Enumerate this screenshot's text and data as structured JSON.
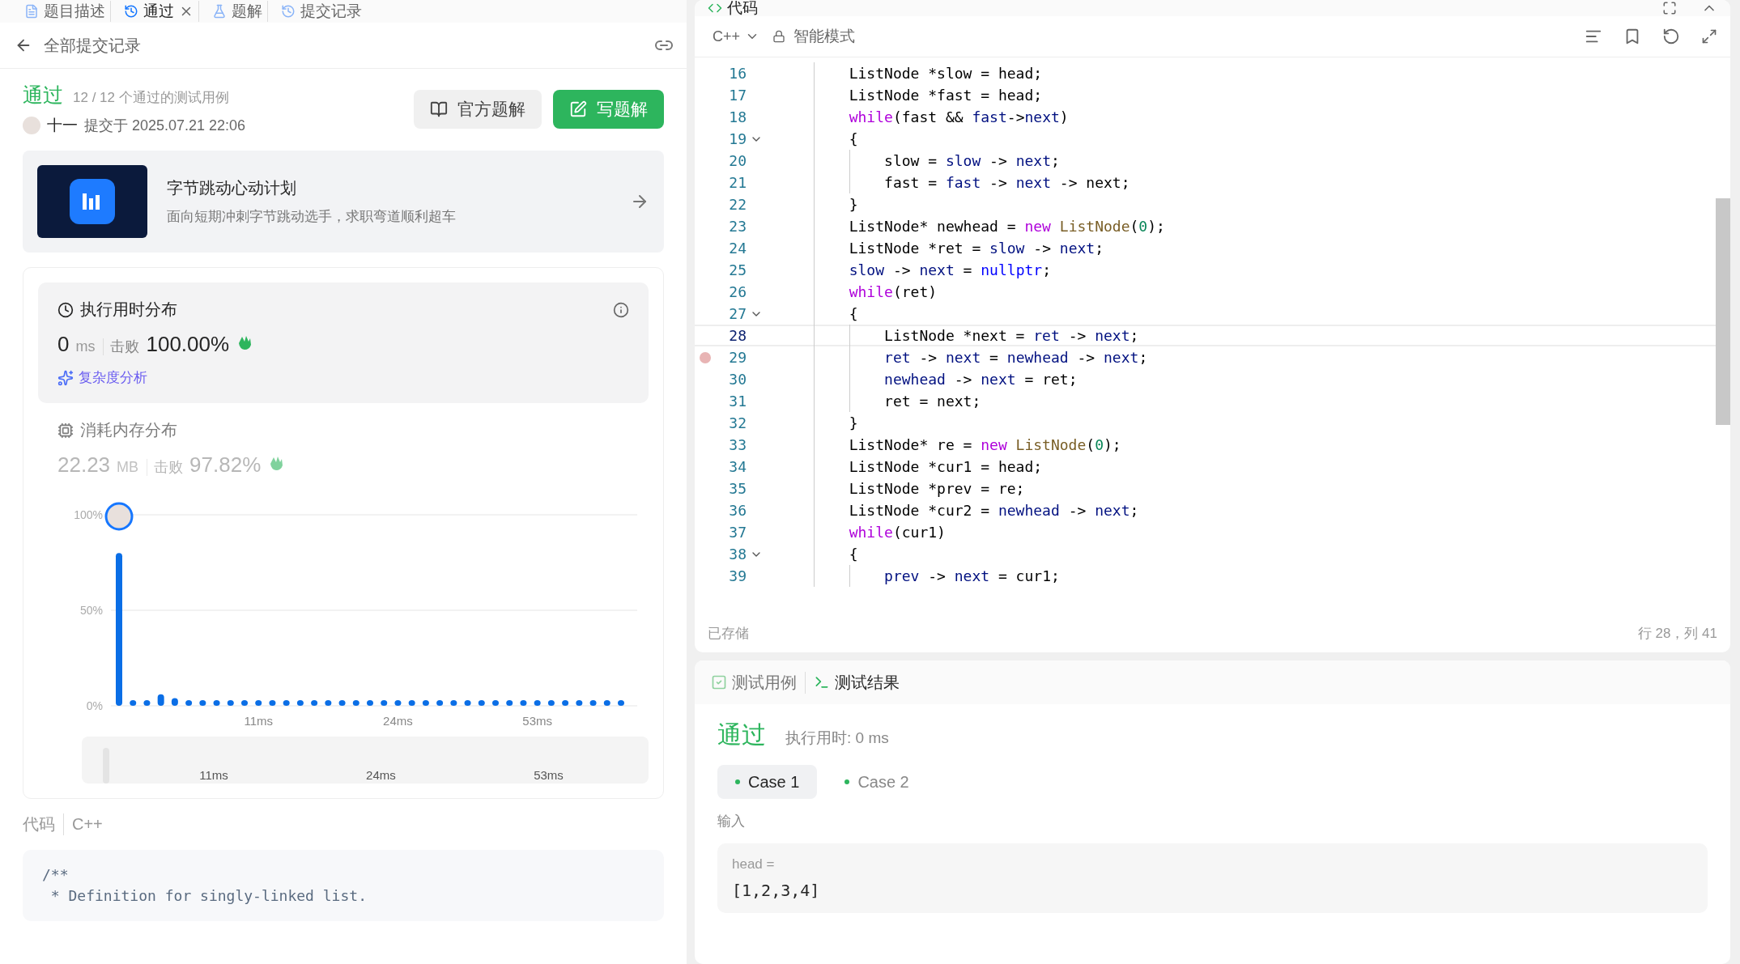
{
  "left_tabs": [
    {
      "label": "题目描述",
      "selected": false,
      "closable": false
    },
    {
      "label": "通过",
      "selected": true,
      "closable": true
    },
    {
      "label": "题解",
      "selected": false,
      "closable": false
    },
    {
      "label": "提交记录",
      "selected": false,
      "closable": false
    }
  ],
  "back_label": "全部提交记录",
  "submission": {
    "status": "通过",
    "cases": "12 / 12 个通过的测试用例",
    "user": "十一",
    "submitted": "提交于 2025.07.21 22:06"
  },
  "actions": [
    {
      "label": "官方题解",
      "kind": "secondary"
    },
    {
      "label": "写题解",
      "kind": "primary"
    }
  ],
  "promo": {
    "title": "字节跳动心动计划",
    "subtitle": "面向短期冲刺字节跳动选手，求职弯道顺利超车"
  },
  "runtime": {
    "title": "执行用时分布",
    "value": "0",
    "unit": "ms",
    "beats_label": "击败",
    "beats": "100.00%",
    "link": "复杂度分析",
    "selected": true
  },
  "memory": {
    "title": "消耗内存分布",
    "value": "22.23",
    "unit": "MB",
    "beats_label": "击败",
    "beats": "97.82%",
    "selected": false
  },
  "distribution": {
    "chart_data": {
      "type": "bar",
      "ylim": [
        0,
        100
      ],
      "yticks": [
        {
          "value": 0,
          "label": "0%"
        },
        {
          "value": 50,
          "label": "50%"
        },
        {
          "value": 100,
          "label": "100%"
        }
      ],
      "categories": [
        null,
        null,
        null,
        null,
        null,
        null,
        null,
        null,
        null,
        null,
        "11ms",
        null,
        null,
        null,
        null,
        null,
        null,
        null,
        null,
        null,
        "24ms",
        null,
        null,
        null,
        null,
        null,
        null,
        null,
        null,
        null,
        "53ms",
        null,
        null,
        null,
        null,
        null,
        null
      ],
      "values": [
        80,
        3,
        3,
        6,
        4,
        3,
        3,
        3,
        3,
        3,
        3,
        3,
        3,
        3,
        3,
        3,
        3,
        3,
        3,
        3,
        3,
        3,
        3,
        3,
        3,
        3,
        3,
        3,
        3,
        3,
        3,
        3,
        3,
        3,
        3,
        3,
        3
      ]
    },
    "overview_labels": [
      "11ms",
      "24ms",
      "53ms"
    ]
  },
  "code_preview": {
    "label": "代码",
    "language": "C++",
    "lines": [
      "/**",
      " * Definition for singly-linked list."
    ]
  },
  "editor": {
    "tab": "代码",
    "language": "C++",
    "mode": "智能模式",
    "status": "已存储",
    "cursor": "行 28，列 41",
    "lines": [
      {
        "num": "16",
        "fold": false,
        "current": false,
        "breakpoint": false,
        "tokens": [
          {
            "text": "        ListNode *slow = head;",
            "kind": "plain"
          }
        ]
      },
      {
        "num": "17",
        "fold": false,
        "current": false,
        "breakpoint": false,
        "tokens": [
          {
            "text": "        ListNode *fast = head;",
            "kind": "plain"
          }
        ]
      },
      {
        "num": "18",
        "fold": false,
        "current": false,
        "breakpoint": false,
        "tokens": [
          {
            "text": "        while",
            "kind": "keyword"
          },
          {
            "text": "(fast && ",
            "kind": "plain"
          },
          {
            "text": "fast",
            "kind": "variable"
          },
          {
            "text": "->",
            "kind": "plain"
          },
          {
            "text": "next",
            "kind": "variable"
          },
          {
            "text": ")",
            "kind": "plain"
          }
        ]
      },
      {
        "num": "19",
        "fold": true,
        "current": false,
        "breakpoint": false,
        "tokens": [
          {
            "text": "        {",
            "kind": "plain"
          }
        ]
      },
      {
        "num": "20",
        "fold": false,
        "current": false,
        "breakpoint": false,
        "tokens": [
          {
            "text": "            slow = ",
            "kind": "plain"
          },
          {
            "text": "slow",
            "kind": "variable"
          },
          {
            "text": " -> ",
            "kind": "plain"
          },
          {
            "text": "next",
            "kind": "variable"
          },
          {
            "text": ";",
            "kind": "plain"
          }
        ]
      },
      {
        "num": "21",
        "fold": false,
        "current": false,
        "breakpoint": false,
        "tokens": [
          {
            "text": "            fast = ",
            "kind": "plain"
          },
          {
            "text": "fast",
            "kind": "variable"
          },
          {
            "text": " -> ",
            "kind": "plain"
          },
          {
            "text": "next",
            "kind": "variable"
          },
          {
            "text": " -> next;",
            "kind": "plain"
          }
        ]
      },
      {
        "num": "22",
        "fold": false,
        "current": false,
        "breakpoint": false,
        "tokens": [
          {
            "text": "        }",
            "kind": "plain"
          }
        ]
      },
      {
        "num": "23",
        "fold": false,
        "current": false,
        "breakpoint": false,
        "tokens": [
          {
            "text": "        ListNode* newhead = ",
            "kind": "plain"
          },
          {
            "text": "new",
            "kind": "keyword"
          },
          {
            "text": " ListNode",
            "kind": "class"
          },
          {
            "text": "(",
            "kind": "plain"
          },
          {
            "text": "0",
            "kind": "number"
          },
          {
            "text": ");",
            "kind": "plain"
          }
        ]
      },
      {
        "num": "24",
        "fold": false,
        "current": false,
        "breakpoint": false,
        "tokens": [
          {
            "text": "        ListNode *ret = ",
            "kind": "plain"
          },
          {
            "text": "slow",
            "kind": "variable"
          },
          {
            "text": " -> ",
            "kind": "plain"
          },
          {
            "text": "next",
            "kind": "variable"
          },
          {
            "text": ";",
            "kind": "plain"
          }
        ]
      },
      {
        "num": "25",
        "fold": false,
        "current": false,
        "breakpoint": false,
        "tokens": [
          {
            "text": "        slow",
            "kind": "variable"
          },
          {
            "text": " -> ",
            "kind": "plain"
          },
          {
            "text": "next",
            "kind": "variable"
          },
          {
            "text": " = ",
            "kind": "plain"
          },
          {
            "text": "nullptr",
            "kind": "literal"
          },
          {
            "text": ";",
            "kind": "plain"
          }
        ]
      },
      {
        "num": "26",
        "fold": false,
        "current": false,
        "breakpoint": false,
        "tokens": [
          {
            "text": "        while",
            "kind": "keyword"
          },
          {
            "text": "(ret)",
            "kind": "plain"
          }
        ]
      },
      {
        "num": "27",
        "fold": true,
        "current": false,
        "breakpoint": false,
        "tokens": [
          {
            "text": "        {",
            "kind": "plain"
          }
        ]
      },
      {
        "num": "28",
        "fold": false,
        "current": true,
        "breakpoint": false,
        "tokens": [
          {
            "text": "            ListNode *next = ",
            "kind": "plain"
          },
          {
            "text": "ret",
            "kind": "variable"
          },
          {
            "text": " -> ",
            "kind": "plain"
          },
          {
            "text": "next",
            "kind": "variable"
          },
          {
            "text": ";",
            "kind": "plain"
          }
        ]
      },
      {
        "num": "29",
        "fold": false,
        "current": false,
        "breakpoint": true,
        "tokens": [
          {
            "text": "            ret",
            "kind": "variable"
          },
          {
            "text": " -> ",
            "kind": "plain"
          },
          {
            "text": "next",
            "kind": "variable"
          },
          {
            "text": " = ",
            "kind": "plain"
          },
          {
            "text": "newhead",
            "kind": "variable"
          },
          {
            "text": " -> ",
            "kind": "plain"
          },
          {
            "text": "next",
            "kind": "variable"
          },
          {
            "text": ";",
            "kind": "plain"
          }
        ]
      },
      {
        "num": "30",
        "fold": false,
        "current": false,
        "breakpoint": false,
        "tokens": [
          {
            "text": "            newhead",
            "kind": "variable"
          },
          {
            "text": " -> ",
            "kind": "plain"
          },
          {
            "text": "next",
            "kind": "variable"
          },
          {
            "text": " = ret;",
            "kind": "plain"
          }
        ]
      },
      {
        "num": "31",
        "fold": false,
        "current": false,
        "breakpoint": false,
        "tokens": [
          {
            "text": "            ret = next;",
            "kind": "plain"
          }
        ]
      },
      {
        "num": "32",
        "fold": false,
        "current": false,
        "breakpoint": false,
        "tokens": [
          {
            "text": "        }",
            "kind": "plain"
          }
        ]
      },
      {
        "num": "33",
        "fold": false,
        "current": false,
        "breakpoint": false,
        "tokens": [
          {
            "text": "        ListNode* re = ",
            "kind": "plain"
          },
          {
            "text": "new",
            "kind": "keyword"
          },
          {
            "text": " ListNode",
            "kind": "class"
          },
          {
            "text": "(",
            "kind": "plain"
          },
          {
            "text": "0",
            "kind": "number"
          },
          {
            "text": ");",
            "kind": "plain"
          }
        ]
      },
      {
        "num": "34",
        "fold": false,
        "current": false,
        "breakpoint": false,
        "tokens": [
          {
            "text": "        ListNode *cur1 = head;",
            "kind": "plain"
          }
        ]
      },
      {
        "num": "35",
        "fold": false,
        "current": false,
        "breakpoint": false,
        "tokens": [
          {
            "text": "        ListNode *prev = re;",
            "kind": "plain"
          }
        ]
      },
      {
        "num": "36",
        "fold": false,
        "current": false,
        "breakpoint": false,
        "tokens": [
          {
            "text": "        ListNode *cur2 = ",
            "kind": "plain"
          },
          {
            "text": "newhead",
            "kind": "variable"
          },
          {
            "text": " -> ",
            "kind": "plain"
          },
          {
            "text": "next",
            "kind": "variable"
          },
          {
            "text": ";",
            "kind": "plain"
          }
        ]
      },
      {
        "num": "37",
        "fold": false,
        "current": false,
        "breakpoint": false,
        "tokens": [
          {
            "text": "        while",
            "kind": "keyword"
          },
          {
            "text": "(cur1)",
            "kind": "plain"
          }
        ]
      },
      {
        "num": "38",
        "fold": true,
        "current": false,
        "breakpoint": false,
        "tokens": [
          {
            "text": "        {",
            "kind": "plain"
          }
        ]
      },
      {
        "num": "39",
        "fold": false,
        "current": false,
        "breakpoint": false,
        "tokens": [
          {
            "text": "            prev",
            "kind": "variable"
          },
          {
            "text": " -> ",
            "kind": "plain"
          },
          {
            "text": "next",
            "kind": "variable"
          },
          {
            "text": " = cur1;",
            "kind": "plain"
          }
        ]
      }
    ]
  },
  "console": {
    "tabs": [
      {
        "label": "测试用例",
        "selected": false,
        "kind": "cases"
      },
      {
        "label": "测试结果",
        "selected": true,
        "kind": "result"
      }
    ],
    "result": "通过",
    "runtime": "执行用时: 0 ms",
    "cases": [
      {
        "label": "Case 1",
        "selected": true
      },
      {
        "label": "Case 2",
        "selected": false
      }
    ],
    "input_label": "输入",
    "inputs": [
      {
        "name": "head =",
        "value": "[1,2,3,4]"
      }
    ]
  }
}
